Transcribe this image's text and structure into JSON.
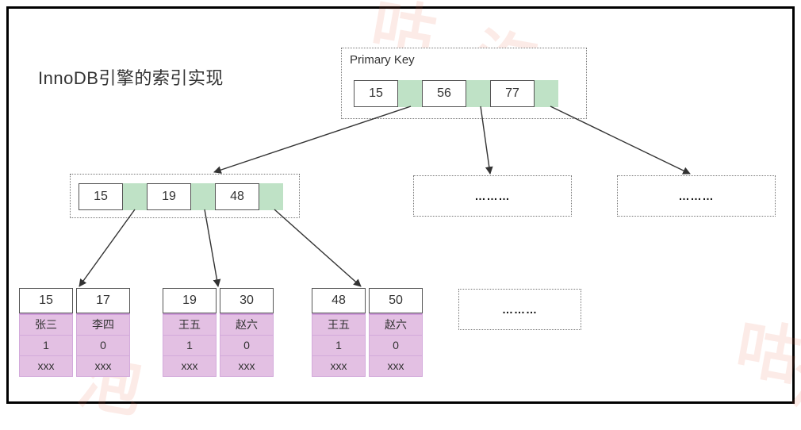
{
  "title": "InnoDB引擎的索引实现",
  "root": {
    "label": "Primary Key",
    "keys": [
      "15",
      "56",
      "77"
    ]
  },
  "internal": {
    "keys": [
      "15",
      "19",
      "48"
    ]
  },
  "placeholders": {
    "mid_right": "………",
    "far_right": "………",
    "leaf_right": "………"
  },
  "leaves": [
    {
      "keys": [
        "15",
        "17"
      ],
      "cols": [
        {
          "name": "张三",
          "flag": "1",
          "more": "xxx"
        },
        {
          "name": "李四",
          "flag": "0",
          "more": "xxx"
        }
      ]
    },
    {
      "keys": [
        "19",
        "30"
      ],
      "cols": [
        {
          "name": "王五",
          "flag": "1",
          "more": "xxx"
        },
        {
          "name": "赵六",
          "flag": "0",
          "more": "xxx"
        }
      ]
    },
    {
      "keys": [
        "48",
        "50"
      ],
      "cols": [
        {
          "name": "王五",
          "flag": "1",
          "more": "xxx"
        },
        {
          "name": "赵六",
          "flag": "0",
          "more": "xxx"
        }
      ]
    }
  ],
  "watermark": {
    "char1": "咕",
    "char2": "泡"
  }
}
